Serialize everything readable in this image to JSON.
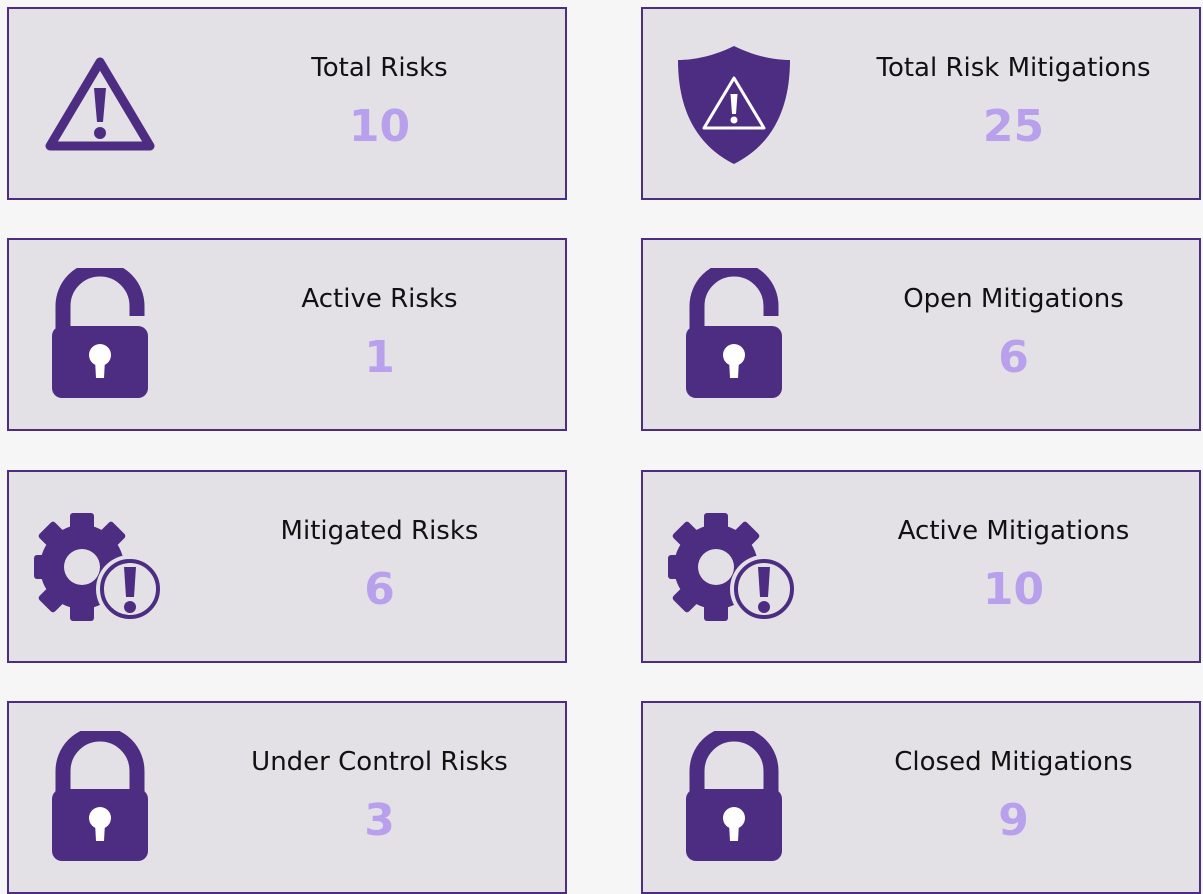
{
  "theme": {
    "card_background": "#e4e1e6",
    "card_border": "#4d2d82",
    "icon_color": "#4d2d82",
    "value_color": "#b9a0ec",
    "label_color": "#111111"
  },
  "cards": [
    {
      "label": "Total Risks",
      "value": "10",
      "icon": "warning-triangle-icon"
    },
    {
      "label": "Total Risk Mitigations",
      "value": "25",
      "icon": "shield-warning-icon"
    },
    {
      "label": "Active Risks",
      "value": "1",
      "icon": "unlocked-padlock-icon"
    },
    {
      "label": "Open Mitigations",
      "value": "6",
      "icon": "unlocked-padlock-icon"
    },
    {
      "label": "Mitigated Risks",
      "value": "6",
      "icon": "gear-alert-icon"
    },
    {
      "label": "Active Mitigations",
      "value": "10",
      "icon": "gear-alert-icon"
    },
    {
      "label": "Under Control Risks",
      "value": "3",
      "icon": "locked-padlock-icon"
    },
    {
      "label": "Closed Mitigations",
      "value": "9",
      "icon": "locked-padlock-icon"
    }
  ]
}
